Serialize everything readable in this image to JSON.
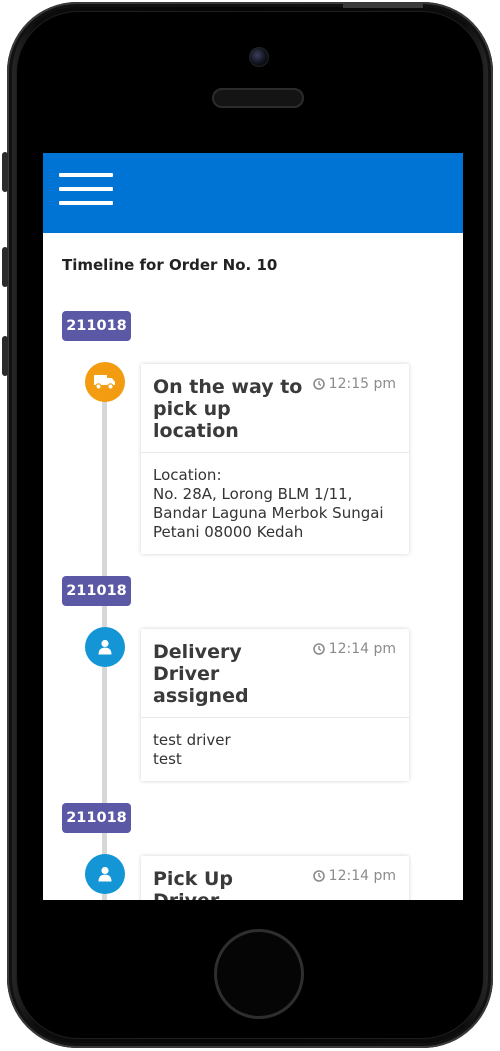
{
  "page": {
    "title": "Timeline for Order No. 10"
  },
  "timeline": [
    {
      "date": "211018",
      "icon": "truck-icon",
      "icon_color": "#f39c12",
      "title": "On the way to pick up location",
      "time": "12:15 pm",
      "body_lines": [
        "Location:",
        "No. 28A, Lorong BLM 1/11, Bandar Laguna Merbok Sungai Petani 08000 Kedah"
      ]
    },
    {
      "date": "211018",
      "icon": "user-icon",
      "icon_color": "#1395d6",
      "title": "Delivery Driver assigned",
      "time": "12:14 pm",
      "body_lines": [
        "test driver",
        "test"
      ]
    },
    {
      "date": "211018",
      "icon": "user-icon",
      "icon_color": "#1395d6",
      "title": "Pick Up Driver assigned",
      "time": "12:14 pm",
      "body_lines": []
    }
  ],
  "colors": {
    "navbar": "#0074d4",
    "date_badge": "#5b58a6",
    "timeline_line": "#d7d7d7"
  }
}
